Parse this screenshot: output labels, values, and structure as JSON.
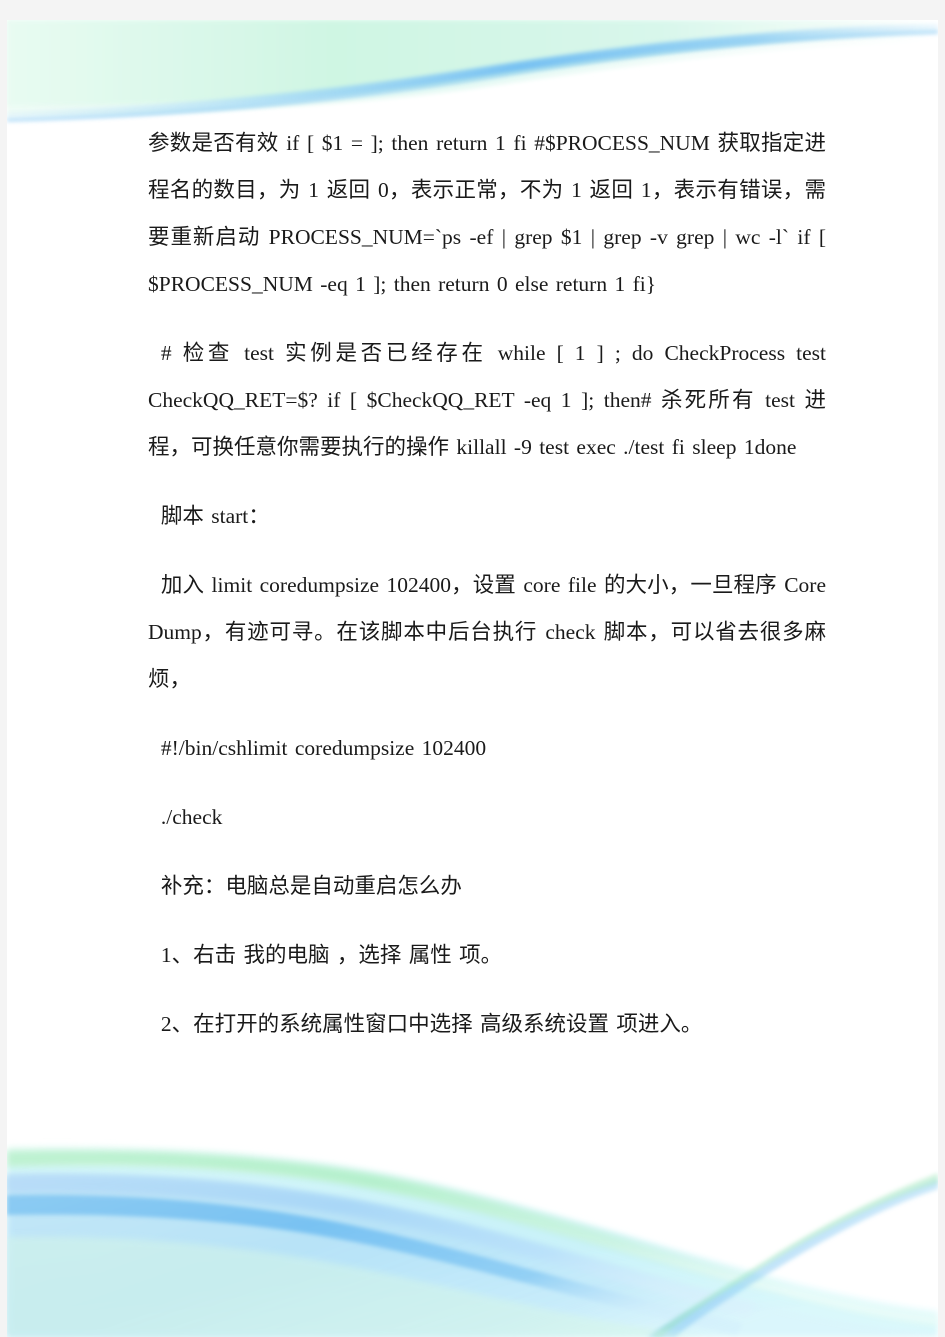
{
  "page": {
    "background_color": "#f4f4f4",
    "sheet_color": "#ffffff",
    "text_color": "#1a1a1a"
  },
  "decoration": {
    "top_graphic": "wave-band-graphic",
    "bottom_graphic": "wave-band-graphic",
    "colors": {
      "blue_strong": "#7ec4f2",
      "blue_mid": "#a8d8f7",
      "blue_pale": "#cdebfb",
      "green_mid": "#aef0c4",
      "green_pale": "#d9f7e4",
      "cyan_pale": "#d6f6f7",
      "white": "#ffffff"
    }
  },
  "document": {
    "paragraphs": [
      {
        "id": "para-check-process",
        "style": "flush",
        "text": "参数是否有效 if [ $1 = ]; then return 1 fi #$PROCESS_NUM 获取指定进程名的数目，为 1 返回 0，表示正常，不为 1 返回 1，表示有错误，需要重新启动 PROCESS_NUM=`ps -ef | grep $1 | grep -v grep | wc -l` if [ $PROCESS_NUM -eq 1 ]; then return 0 else return 1 fi}"
      },
      {
        "id": "para-check-test-instance",
        "style": "indent",
        "text": "# 检查 test 实例是否已经存在 while [ 1 ] ; do CheckProcess test CheckQQ_RET=$? if [ $CheckQQ_RET -eq 1 ]; then# 杀死所有 test 进程，可换任意你需要执行的操作 killall -9 test exec ./test fi sleep 1done"
      },
      {
        "id": "para-script-start",
        "style": "indent short",
        "text": "脚本 start："
      },
      {
        "id": "para-coredumpsize",
        "style": "indent",
        "text": "加入 limit coredumpsize 102400，设置 core file 的大小，一旦程序 Core Dump，有迹可寻。在该脚本中后台执行 check 脚本，可以省去很多麻烦，"
      },
      {
        "id": "para-shebang",
        "style": "indent short",
        "text": "#!/bin/cshlimit coredumpsize 102400"
      },
      {
        "id": "para-check-cmd",
        "style": "indent short",
        "text": "./check"
      },
      {
        "id": "para-supplement-title",
        "style": "indent short",
        "text": "补充：电脑总是自动重启怎么办"
      },
      {
        "id": "para-step-1",
        "style": "indent short",
        "text": "1、右击 我的电脑 ，选择 属性 项。"
      },
      {
        "id": "para-step-2",
        "style": "indent short",
        "text": "2、在打开的系统属性窗口中选择 高级系统设置 项进入。"
      }
    ]
  }
}
